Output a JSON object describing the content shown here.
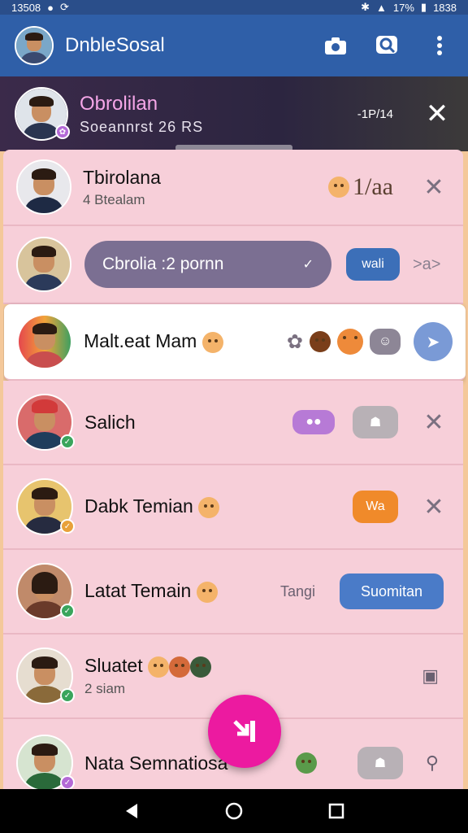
{
  "status": {
    "time": "13508",
    "battery": "17%",
    "clock": "1838"
  },
  "app": {
    "title": "DnbleSosal",
    "icons": [
      "camera-icon",
      "search-icon",
      "more-vert-icon"
    ]
  },
  "banner": {
    "name": "Obrolilan",
    "subtitle": "Soeannrst 26 RS",
    "count": "-1P/14"
  },
  "chats": [
    {
      "name": "Tbirolana",
      "sub": "4 Btealam",
      "meta": "1/aa"
    },
    {
      "pill": "Cbrolia :2 pornn",
      "chip": "wali",
      "meta": ">a>"
    },
    {
      "name": "Malt.eat Mam"
    },
    {
      "name": "Salich"
    },
    {
      "name": "Dabk Temian",
      "chip": "Wa"
    },
    {
      "name": "Latat Temain",
      "meta": "Tangi",
      "chip": "Suomitan"
    },
    {
      "name": "Sluatet",
      "sub": "2 siam"
    },
    {
      "name": "Nata Semnatiosa"
    }
  ],
  "colors": {
    "accent": "#ec1aa0",
    "appbar": "#2f5fa8",
    "row": "#f7cfd9"
  }
}
